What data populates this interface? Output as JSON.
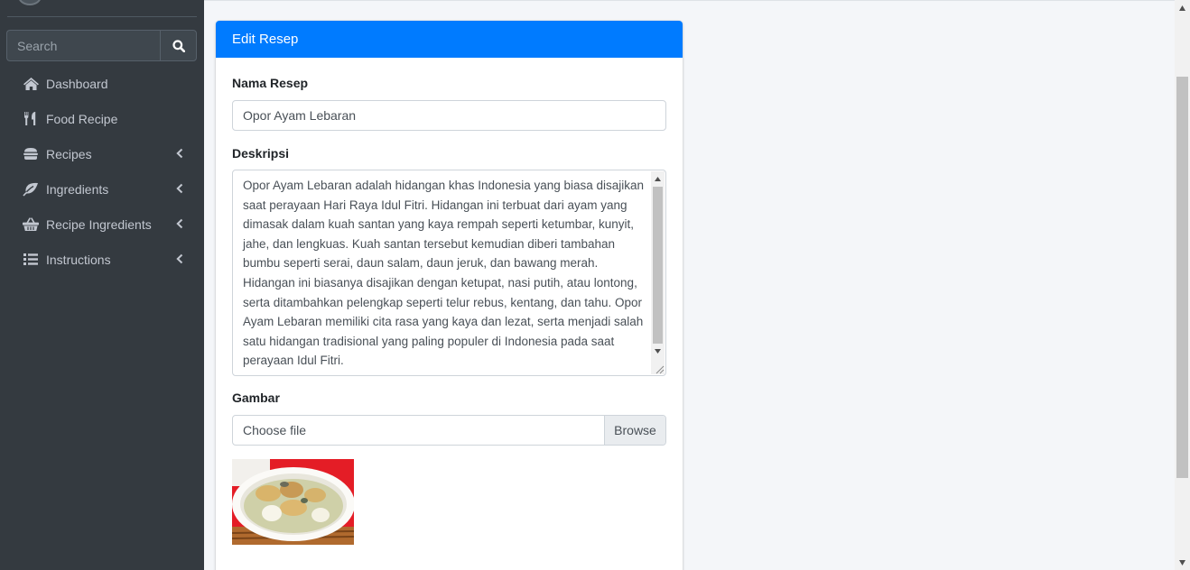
{
  "sidebar": {
    "search_placeholder": "Search",
    "items": [
      {
        "label": "Dashboard",
        "icon": "home-icon",
        "has_caret": false
      },
      {
        "label": "Food Recipe",
        "icon": "utensils-icon",
        "has_caret": false
      },
      {
        "label": "Recipes",
        "icon": "hamburger-icon",
        "has_caret": true
      },
      {
        "label": "Ingredients",
        "icon": "leaf-icon",
        "has_caret": true
      },
      {
        "label": "Recipe Ingredients",
        "icon": "basket-icon",
        "has_caret": true
      },
      {
        "label": "Instructions",
        "icon": "list-icon",
        "has_caret": true
      }
    ]
  },
  "form": {
    "title": "Edit Resep",
    "name_label": "Nama Resep",
    "name_value": "Opor Ayam Lebaran",
    "description_label": "Deskripsi",
    "description_value": "Opor Ayam Lebaran adalah hidangan khas Indonesia yang biasa disajikan saat perayaan Hari Raya Idul Fitri. Hidangan ini terbuat dari ayam yang dimasak dalam kuah santan yang kaya rempah seperti ketumbar, kunyit, jahe, dan lengkuas. Kuah santan tersebut kemudian diberi tambahan bumbu seperti serai, daun salam, daun jeruk, dan bawang merah. Hidangan ini biasanya disajikan dengan ketupat, nasi putih, atau lontong, serta ditambahkan pelengkap seperti telur rebus, kentang, dan tahu. Opor Ayam Lebaran memiliki cita rasa yang kaya dan lezat, serta menjadi salah satu hidangan tradisional yang paling populer di Indonesia pada saat perayaan Idul Fitri.",
    "image_label": "Gambar",
    "file_placeholder": "Choose file",
    "browse_label": "Browse"
  },
  "colors": {
    "sidebar_bg": "#343a40",
    "primary": "#007bff",
    "sidebar_text": "#c2c7d0"
  }
}
